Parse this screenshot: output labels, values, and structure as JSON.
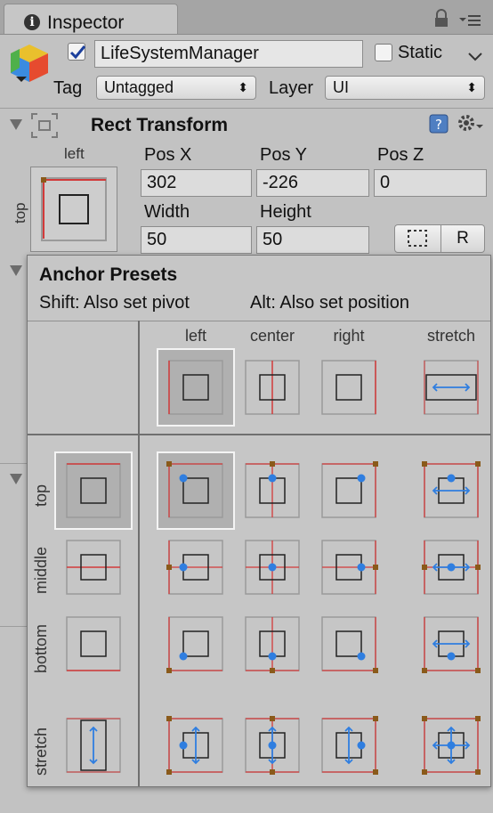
{
  "tab": {
    "title": "Inspector",
    "info_icon": "info-icon",
    "lock_icon": "lock-icon",
    "menu_icon": "tab-menu-icon"
  },
  "object": {
    "icon": "gameobject-cube-icon",
    "active": true,
    "name": "LifeSystemManager",
    "static_label": "Static",
    "static_checked": false,
    "tag_label": "Tag",
    "tag_value": "Untagged",
    "layer_label": "Layer",
    "layer_value": "UI"
  },
  "rect_transform": {
    "title": "Rect Transform",
    "anchor_top_label": "top",
    "anchor_left_label": "left",
    "pos_x_label": "Pos X",
    "pos_x": "302",
    "pos_y_label": "Pos Y",
    "pos_y": "-226",
    "pos_z_label": "Pos Z",
    "pos_z": "0",
    "width_label": "Width",
    "width": "50",
    "height_label": "Height",
    "height": "50",
    "raw_edit_button": "R"
  },
  "anchor_presets": {
    "title": "Anchor Presets",
    "hint_shift": "Shift: Also set pivot",
    "hint_alt": "Alt: Also set position",
    "columns": [
      "left",
      "center",
      "right",
      "stretch"
    ],
    "rows": [
      "top",
      "middle",
      "bottom",
      "stretch"
    ],
    "selected": {
      "row": "top",
      "column": "left"
    },
    "colors": {
      "anchor_line": "#d23a3a",
      "pivot_dot": "#2f7ee0",
      "corner": "#8a5a1a"
    }
  }
}
